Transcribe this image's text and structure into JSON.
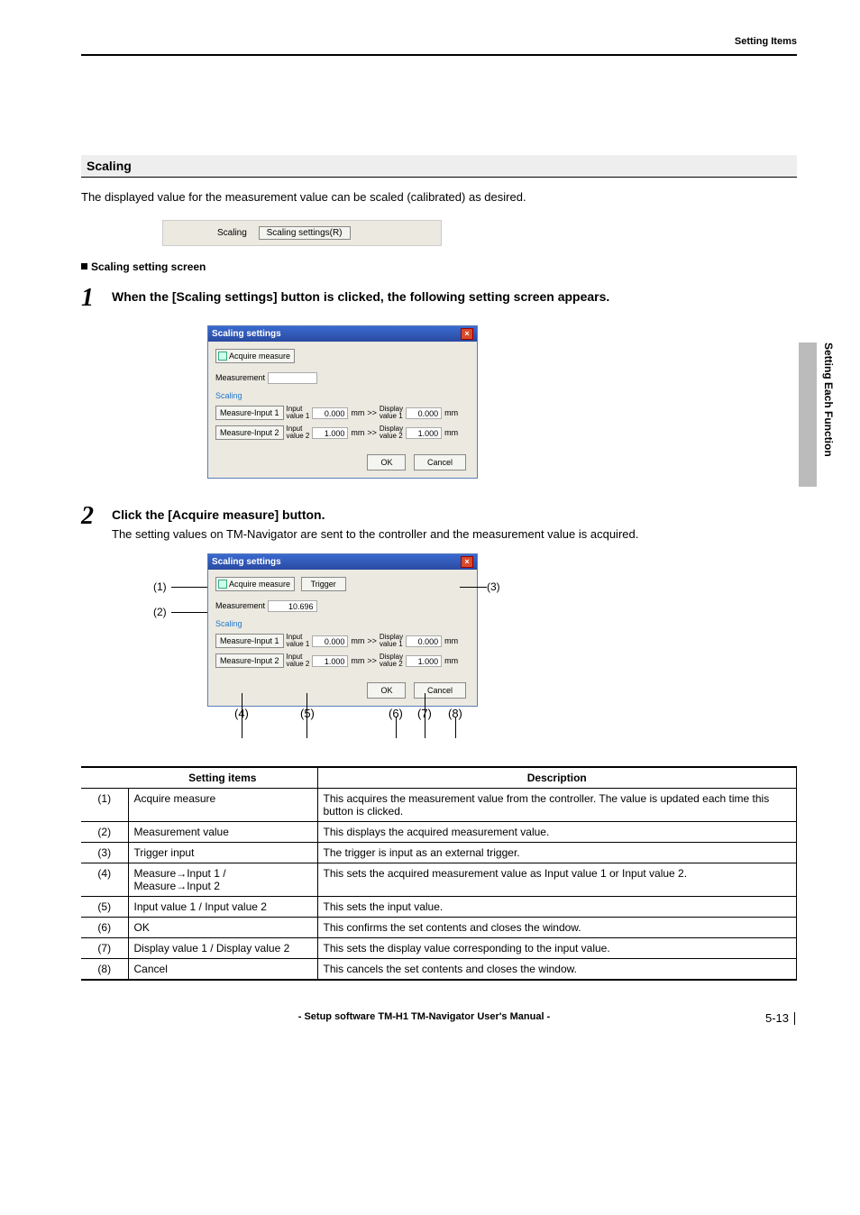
{
  "header": {
    "category": "Setting Items"
  },
  "vtab": "Setting Each Function",
  "section": {
    "heading": "Scaling",
    "intro": "The displayed value for the measurement value can be scaled (calibrated) as desired."
  },
  "bar": {
    "label": "Scaling",
    "button": "Scaling settings(R)"
  },
  "subheading": "Scaling setting screen",
  "step1": {
    "num": "1",
    "title": "When the [Scaling settings] button is clicked, the following setting screen appears."
  },
  "step2": {
    "num": "2",
    "title": "Click the [Acquire measure] button.",
    "desc": "The setting values on TM-Navigator are sent to the controller and the measurement value is acquired."
  },
  "dialog": {
    "title": "Scaling settings",
    "acquire": "Acquire measure",
    "trigger": "Trigger",
    "meas_label": "Measurement",
    "meas_value2": "10.696",
    "scaling_label": "Scaling",
    "row1": {
      "btn": "Measure-Input 1",
      "ilabel": "Input\nvalue 1",
      "iv": "0.000",
      "unit": "mm",
      "arrow": ">>",
      "dlabel": "Display\nvalue 1",
      "dv": "0.000"
    },
    "row2": {
      "btn": "Measure-Input 2",
      "ilabel": "Input\nvalue 2",
      "iv": "1.000",
      "unit": "mm",
      "arrow": ">>",
      "dlabel": "Display\nvalue 2",
      "dv": "1.000"
    },
    "ok": "OK",
    "cancel": "Cancel"
  },
  "callouts": {
    "c1": "(1)",
    "c2": "(2)",
    "c3": "(3)",
    "c4": "(4)",
    "c5": "(5)",
    "c6": "(6)",
    "c7": "(7)",
    "c8": "(8)"
  },
  "table": {
    "h_items": "Setting items",
    "h_desc": "Description",
    "rows": [
      {
        "n": "(1)",
        "item": "Acquire measure",
        "desc": "This acquires the measurement value from the controller. The value is updated each time this button is clicked."
      },
      {
        "n": "(2)",
        "item": "Measurement value",
        "desc": "This displays the acquired measurement value."
      },
      {
        "n": "(3)",
        "item": "Trigger input",
        "desc": "The trigger is input as an external trigger."
      },
      {
        "n": "(4)",
        "item": "Measure→Input 1 /\nMeasure→Input 2",
        "desc": "This sets the acquired measurement value as Input value 1 or Input value 2."
      },
      {
        "n": "(5)",
        "item": "Input value 1 / Input value 2",
        "desc": "This sets the input value."
      },
      {
        "n": "(6)",
        "item": "OK",
        "desc": "This confirms the set contents and closes the window."
      },
      {
        "n": "(7)",
        "item": "Display value 1 / Display value 2",
        "desc": "This sets the display value corresponding to the input value."
      },
      {
        "n": "(8)",
        "item": "Cancel",
        "desc": "This cancels the set contents and closes the window."
      }
    ]
  },
  "footer": {
    "mid": "- Setup software TM-H1 TM-Navigator User's Manual -",
    "page": "5-13"
  }
}
